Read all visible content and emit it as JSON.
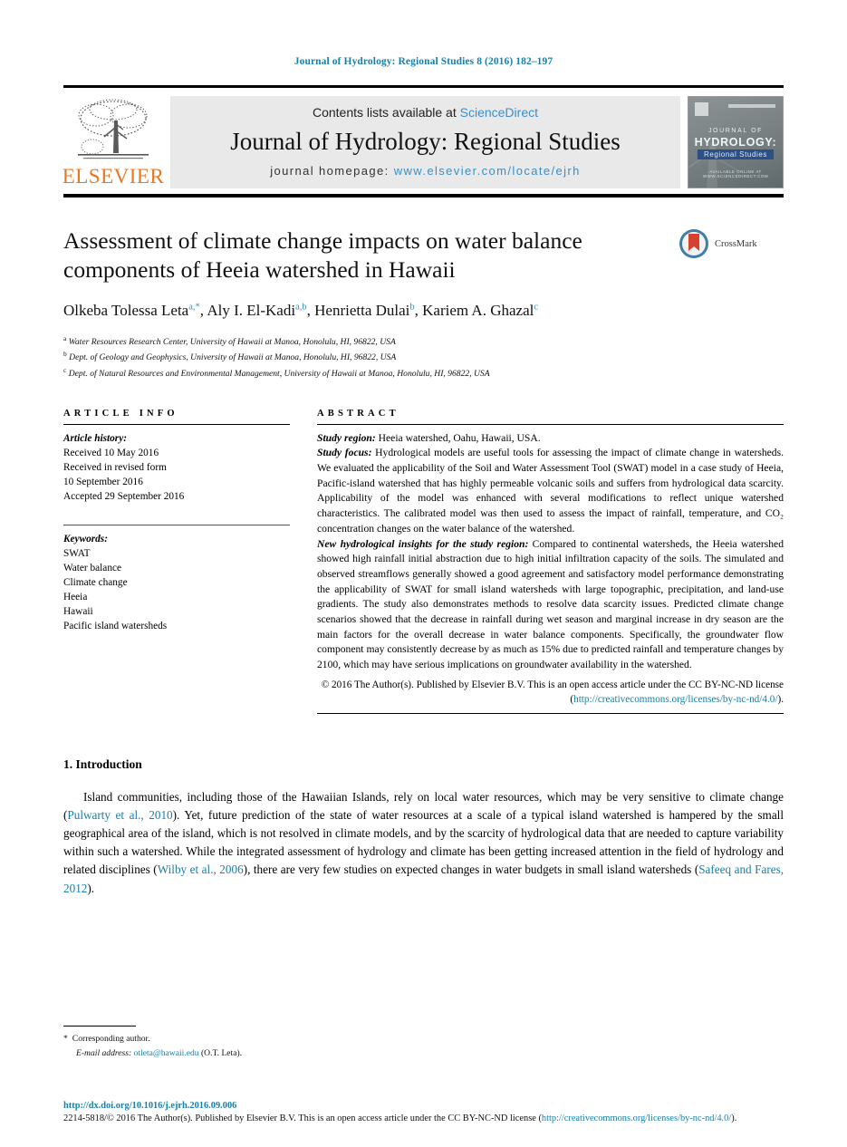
{
  "running_head": "Journal of Hydrology: Regional Studies 8 (2016) 182–197",
  "masthead": {
    "publisher_name": "ELSEVIER",
    "contents_prefix": "Contents lists available at ",
    "contents_link": "ScienceDirect",
    "journal_title": "Journal of Hydrology: Regional Studies",
    "homepage_prefix": "journal homepage: ",
    "homepage_link": "www.elsevier.com/locate/ejrh",
    "cover": {
      "journal_word": "JOURNAL OF",
      "title_word": "HYDROLOGY:",
      "subtitle_word": "Regional Studies",
      "bottom_text": "AVAILABLE ONLINE AT WWW.SCIENCEDIRECT.COM"
    }
  },
  "article": {
    "title": "Assessment of climate change impacts on water balance components of Heeia watershed in Hawaii",
    "crossmark_label": "CrossMark",
    "authors": [
      {
        "name": "Olkeba Tolessa Leta",
        "marks": "a,*"
      },
      {
        "name": "Aly I. El-Kadi",
        "marks": "a,b"
      },
      {
        "name": "Henrietta Dulai",
        "marks": "b"
      },
      {
        "name": "Kariem A. Ghazal",
        "marks": "c"
      }
    ],
    "affiliations": [
      {
        "mark": "a",
        "text": "Water Resources Research Center, University of Hawaii at Manoa, Honolulu, HI, 96822, USA"
      },
      {
        "mark": "b",
        "text": "Dept. of Geology and Geophysics, University of Hawaii at Manoa, Honolulu, HI, 96822, USA"
      },
      {
        "mark": "c",
        "text": "Dept. of Natural Resources and Environmental Management, University of Hawaii at Manoa, Honolulu, HI, 96822, USA"
      }
    ]
  },
  "article_info": {
    "heading": "ARTICLE INFO",
    "history_label": "Article history:",
    "history": [
      "Received 10 May 2016",
      "Received in revised form",
      "10 September 2016",
      "Accepted 29 September 2016"
    ],
    "keywords_label": "Keywords:",
    "keywords": [
      "SWAT",
      "Water balance",
      "Climate change",
      "Heeia",
      "Hawaii",
      "Pacific island watersheds"
    ]
  },
  "abstract": {
    "heading": "ABSTRACT",
    "study_region_label": "Study region:",
    "study_region_text": " Heeia watershed, Oahu, Hawaii, USA.",
    "study_focus_label": "Study focus:",
    "study_focus_text": " Hydrological models are useful tools for assessing the impact of climate change in watersheds. We evaluated the applicability of the Soil and Water Assessment Tool (SWAT) model in a case study of Heeia, Pacific-island watershed that has highly permeable volcanic soils and suffers from hydrological data scarcity. Applicability of the model was enhanced with several modifications to reflect unique watershed characteristics. The calibrated model was then used to assess the impact of rainfall, temperature, and CO₂ concentration changes on the water balance of the watershed.",
    "insights_label": "New hydrological insights for the study region:",
    "insights_text": " Compared to continental watersheds, the Heeia watershed showed high rainfall initial abstraction due to high initial infiltration capacity of the soils. The simulated and observed streamflows generally showed a good agreement and satisfactory model performance demonstrating the applicability of SWAT for small island watersheds with large topographic, precipitation, and land-use gradients. The study also demonstrates methods to resolve data scarcity issues. Predicted climate change scenarios showed that the decrease in rainfall during wet season and marginal increase in dry season are the main factors for the overall decrease in water balance components. Specifically, the groundwater flow component may consistently decrease by as much as 15% due to predicted rainfall and temperature changes by 2100, which may have serious implications on groundwater availability in the watershed.",
    "copyright_text": "© 2016 The Author(s). Published by Elsevier B.V. This is an open access article under the CC BY-NC-ND license (",
    "copyright_link": "http://creativecommons.org/licenses/by-nc-nd/4.0/",
    "copyright_tail": ")."
  },
  "introduction": {
    "number_and_title": "1. Introduction",
    "paragraph_parts": [
      {
        "type": "text",
        "value": "Island communities, including those of the Hawaiian Islands, rely on local water resources, which may be very sensitive to climate change ("
      },
      {
        "type": "ref",
        "value": "Pulwarty et al., 2010"
      },
      {
        "type": "text",
        "value": "). Yet, future prediction of the state of water resources at a scale of a typical island watershed is hampered by the small geographical area of the island, which is not resolved in climate models, and by the scarcity of hydrological data that are needed to capture variability within such a watershed. While the integrated assessment of hydrology and climate has been getting increased attention in the field of hydrology and related disciplines ("
      },
      {
        "type": "ref",
        "value": "Wilby et al., 2006"
      },
      {
        "type": "text",
        "value": "), there are very few studies on expected changes in water budgets in small island watersheds ("
      },
      {
        "type": "ref",
        "value": "Safeeq and Fares, 2012"
      },
      {
        "type": "text",
        "value": ")."
      }
    ]
  },
  "footnotes": {
    "corresponding_star": "*",
    "corresponding_text": "Corresponding author.",
    "email_label": "E-mail address:",
    "email_link": "otleta@hawaii.edu",
    "email_tail": " (O.T. Leta)."
  },
  "bottom": {
    "doi": "http://dx.doi.org/10.1016/j.ejrh.2016.09.006",
    "issn_prefix": "2214-5818/© 2016 The Author(s). Published by Elsevier B.V. This is an open access article under the CC BY-NC-ND license (",
    "issn_link": "http://creativecommons.org/licenses/by-nc-nd/4.0/",
    "issn_tail": ")."
  },
  "colors": {
    "link_blue": "#1a7fa8",
    "sciencedirect_blue": "#3b8fc4",
    "elsevier_orange": "#E87722",
    "crossmark_red": "#d5422e"
  }
}
